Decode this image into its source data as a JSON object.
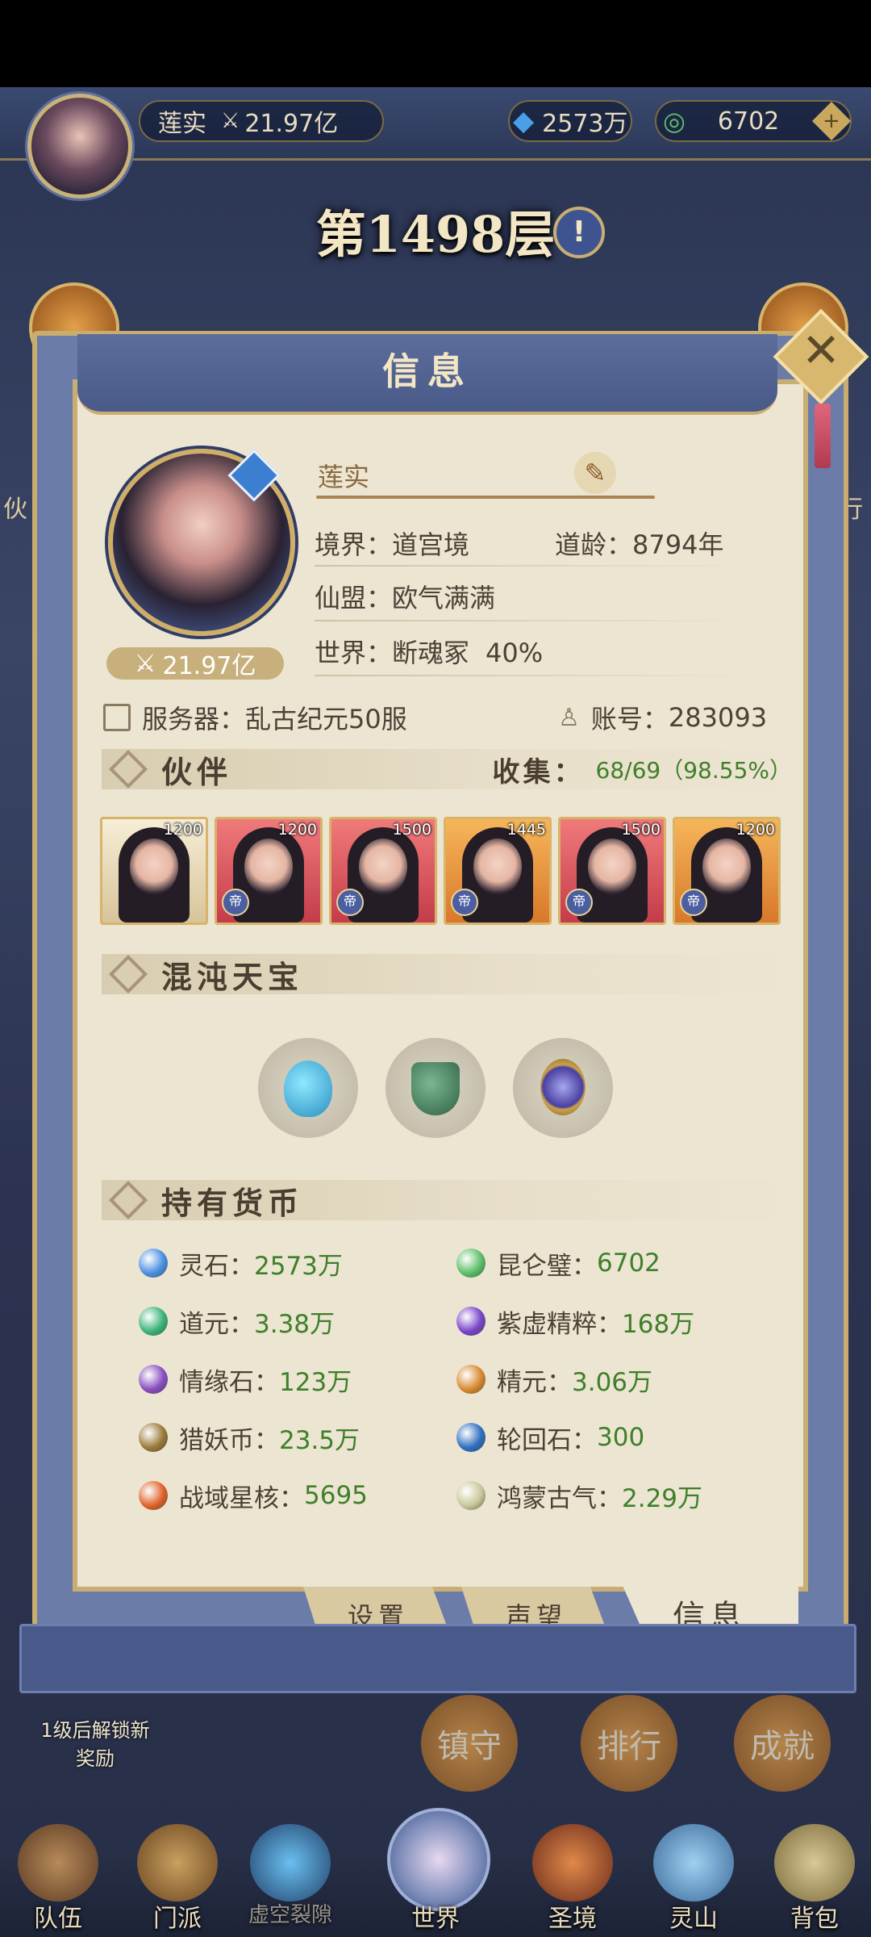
{
  "topbar": {
    "player_name": "莲实",
    "power": "21.97亿",
    "spirit_stones": "2573万",
    "jade": "6702"
  },
  "floor": {
    "label": "第1498层"
  },
  "side": {
    "left_partial": "伙",
    "right_partial": "行"
  },
  "panel": {
    "title": "信息",
    "profile": {
      "name": "莲实",
      "realm_label": "境界：",
      "realm_value": "道宫境",
      "age_label": "道龄：",
      "age_value": "8794年",
      "alliance_label": "仙盟：",
      "alliance_value": "欧气满满",
      "world_label": "世界：",
      "world_value": "断魂冢",
      "world_pct": "40%",
      "power": "21.97亿",
      "server_label": "服务器：",
      "server_value": "乱古纪元50服",
      "account_label": "账号：",
      "account_value": "283093"
    },
    "partners": {
      "title": "伙伴",
      "collect_label": "收集：",
      "collect_value": "68/69（98.55%）",
      "items": [
        {
          "level": "1200",
          "rarity": "gold",
          "tag": ""
        },
        {
          "level": "1200",
          "rarity": "red",
          "tag": "帝"
        },
        {
          "level": "1500",
          "rarity": "red",
          "tag": "帝"
        },
        {
          "level": "1445",
          "rarity": "orange",
          "tag": "帝"
        },
        {
          "level": "1500",
          "rarity": "red",
          "tag": "帝"
        },
        {
          "level": "1200",
          "rarity": "orange",
          "tag": "帝"
        }
      ]
    },
    "treasures": {
      "title": "混沌天宝",
      "icons": [
        "gourd-icon",
        "cauldron-icon",
        "mirror-icon"
      ]
    },
    "currencies": {
      "title": "持有货币",
      "left": [
        {
          "label": "灵石：",
          "value": "2573万",
          "icon": "spirit-stone-icon",
          "color": "#4a90e2"
        },
        {
          "label": "道元：",
          "value": "3.38万",
          "icon": "dao-crystal-icon",
          "color": "#3bb47a"
        },
        {
          "label": "情缘石：",
          "value": "123万",
          "icon": "love-stone-icon",
          "color": "#8a4fc0"
        },
        {
          "label": "猎妖币：",
          "value": "23.5万",
          "icon": "hunt-coin-icon",
          "color": "#9a7a3a"
        },
        {
          "label": "战域星核：",
          "value": "5695",
          "icon": "star-core-icon",
          "color": "#e0622a"
        }
      ],
      "right": [
        {
          "label": "昆仑璧：",
          "value": "6702",
          "icon": "jade-disc-icon",
          "color": "#5cbf6a"
        },
        {
          "label": "紫虚精粹：",
          "value": "168万",
          "icon": "purple-essence-icon",
          "color": "#7a45c8"
        },
        {
          "label": "精元：",
          "value": "3.06万",
          "icon": "essence-orb-icon",
          "color": "#d88a30"
        },
        {
          "label": "轮回石：",
          "value": "300",
          "icon": "yinyang-icon",
          "color": "#2f6fc0"
        },
        {
          "label": "鸿蒙古气：",
          "value": "2.29万",
          "icon": "primal-qi-icon",
          "color": "#c9c89a"
        }
      ]
    },
    "tabs": [
      {
        "label": "设置"
      },
      {
        "label": "声望"
      },
      {
        "label": "信息"
      }
    ]
  },
  "background": {
    "unlock_text_1": "1级后解锁新",
    "unlock_text_2": "奖励",
    "bubbles": [
      "镇守",
      "排行",
      "成就"
    ]
  },
  "bottom_nav": [
    {
      "label": "队伍"
    },
    {
      "label": "门派"
    },
    {
      "label": "虚空裂隙"
    },
    {
      "label": "世界"
    },
    {
      "label": "圣境"
    },
    {
      "label": "灵山"
    },
    {
      "label": "背包"
    }
  ]
}
